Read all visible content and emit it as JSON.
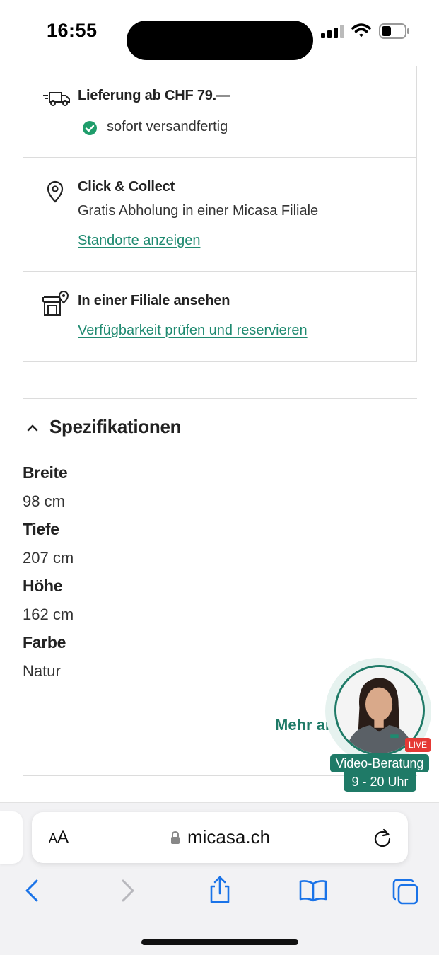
{
  "status_bar": {
    "time": "16:55"
  },
  "delivery": {
    "shipping_title": "Lieferung ab CHF 79.—",
    "shipping_status": "sofort versandfertig",
    "click_collect_title": "Click & Collect",
    "click_collect_text": "Gratis Abholung in einer Micasa Filiale",
    "click_collect_link": "Standorte anzeigen",
    "store_title": "In einer Filiale ansehen",
    "store_link": "Verfügbarkeit prüfen und reservieren"
  },
  "specifications": {
    "heading": "Spezifikationen",
    "items": [
      {
        "label": "Breite",
        "value": "98 cm"
      },
      {
        "label": "Tiefe",
        "value": "207 cm"
      },
      {
        "label": "Höhe",
        "value": "162 cm"
      },
      {
        "label": "Farbe",
        "value": "Natur"
      }
    ],
    "more_link": "Mehr an"
  },
  "video_widget": {
    "live_badge": "LIVE",
    "label": "Video-Beratung",
    "hours": "9 - 20 Uhr"
  },
  "browser": {
    "text_size_button": "AA",
    "url": "micasa.ch"
  },
  "colors": {
    "accent_green": "#1f8a70",
    "live_red": "#e53935"
  }
}
